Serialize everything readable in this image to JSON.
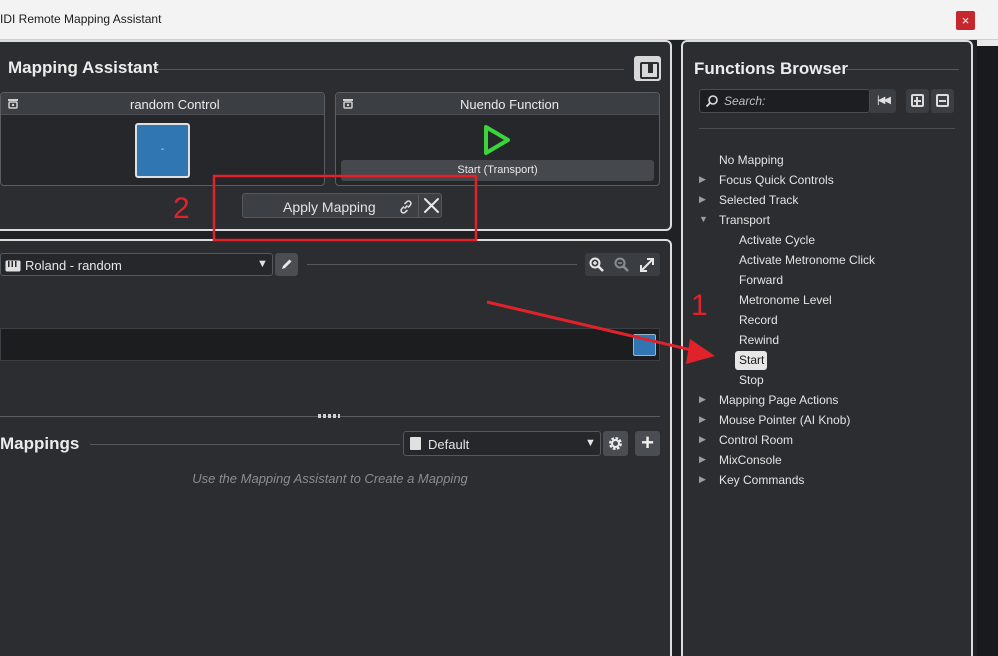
{
  "window": {
    "title": "IDI Remote Mapping Assistant",
    "close_glyph": "×"
  },
  "mapping_assistant": {
    "title": "Mapping Assistant",
    "layout_icon": "layout-toggle-icon",
    "control_card": {
      "title": "random Control",
      "control_value": "-"
    },
    "function_card": {
      "title": "Nuendo Function",
      "function_name": "Start (Transport)",
      "play_color": "#3bd43b"
    },
    "apply_button": "Apply Mapping"
  },
  "device": {
    "selected": "Roland - random"
  },
  "mappings": {
    "title": "Mappings",
    "page_selected": "Default",
    "empty_hint": "Use the Mapping Assistant to Create a Mapping"
  },
  "functions_browser": {
    "title": "Functions Browser",
    "search_placeholder": "Search:",
    "tree": [
      {
        "label": "No Mapping",
        "arrow": ""
      },
      {
        "label": "Focus Quick Controls",
        "arrow": "▶"
      },
      {
        "label": "Selected Track",
        "arrow": "▶"
      },
      {
        "label": "Transport",
        "arrow": "▼"
      },
      {
        "label": "Activate Cycle",
        "arrow": ""
      },
      {
        "label": "Activate Metronome Click",
        "arrow": ""
      },
      {
        "label": "Forward",
        "arrow": ""
      },
      {
        "label": "Metronome Level",
        "arrow": ""
      },
      {
        "label": "Record",
        "arrow": ""
      },
      {
        "label": "Rewind",
        "arrow": ""
      },
      {
        "label": "Start",
        "arrow": ""
      },
      {
        "label": "Stop",
        "arrow": ""
      },
      {
        "label": "Mapping Page Actions",
        "arrow": "▶"
      },
      {
        "label": "Mouse Pointer (AI Knob)",
        "arrow": "▶"
      },
      {
        "label": "Control Room",
        "arrow": "▶"
      },
      {
        "label": "MixConsole",
        "arrow": "▶"
      },
      {
        "label": "Key Commands",
        "arrow": "▶"
      }
    ],
    "selected_item": "Start"
  },
  "annotations": {
    "step1": "1",
    "step2": "2",
    "color": "#e0232a"
  },
  "colors": {
    "accent_blue": "#2f76b3",
    "panel_bg": "#2b2d30",
    "border": "#dcdcdc"
  }
}
